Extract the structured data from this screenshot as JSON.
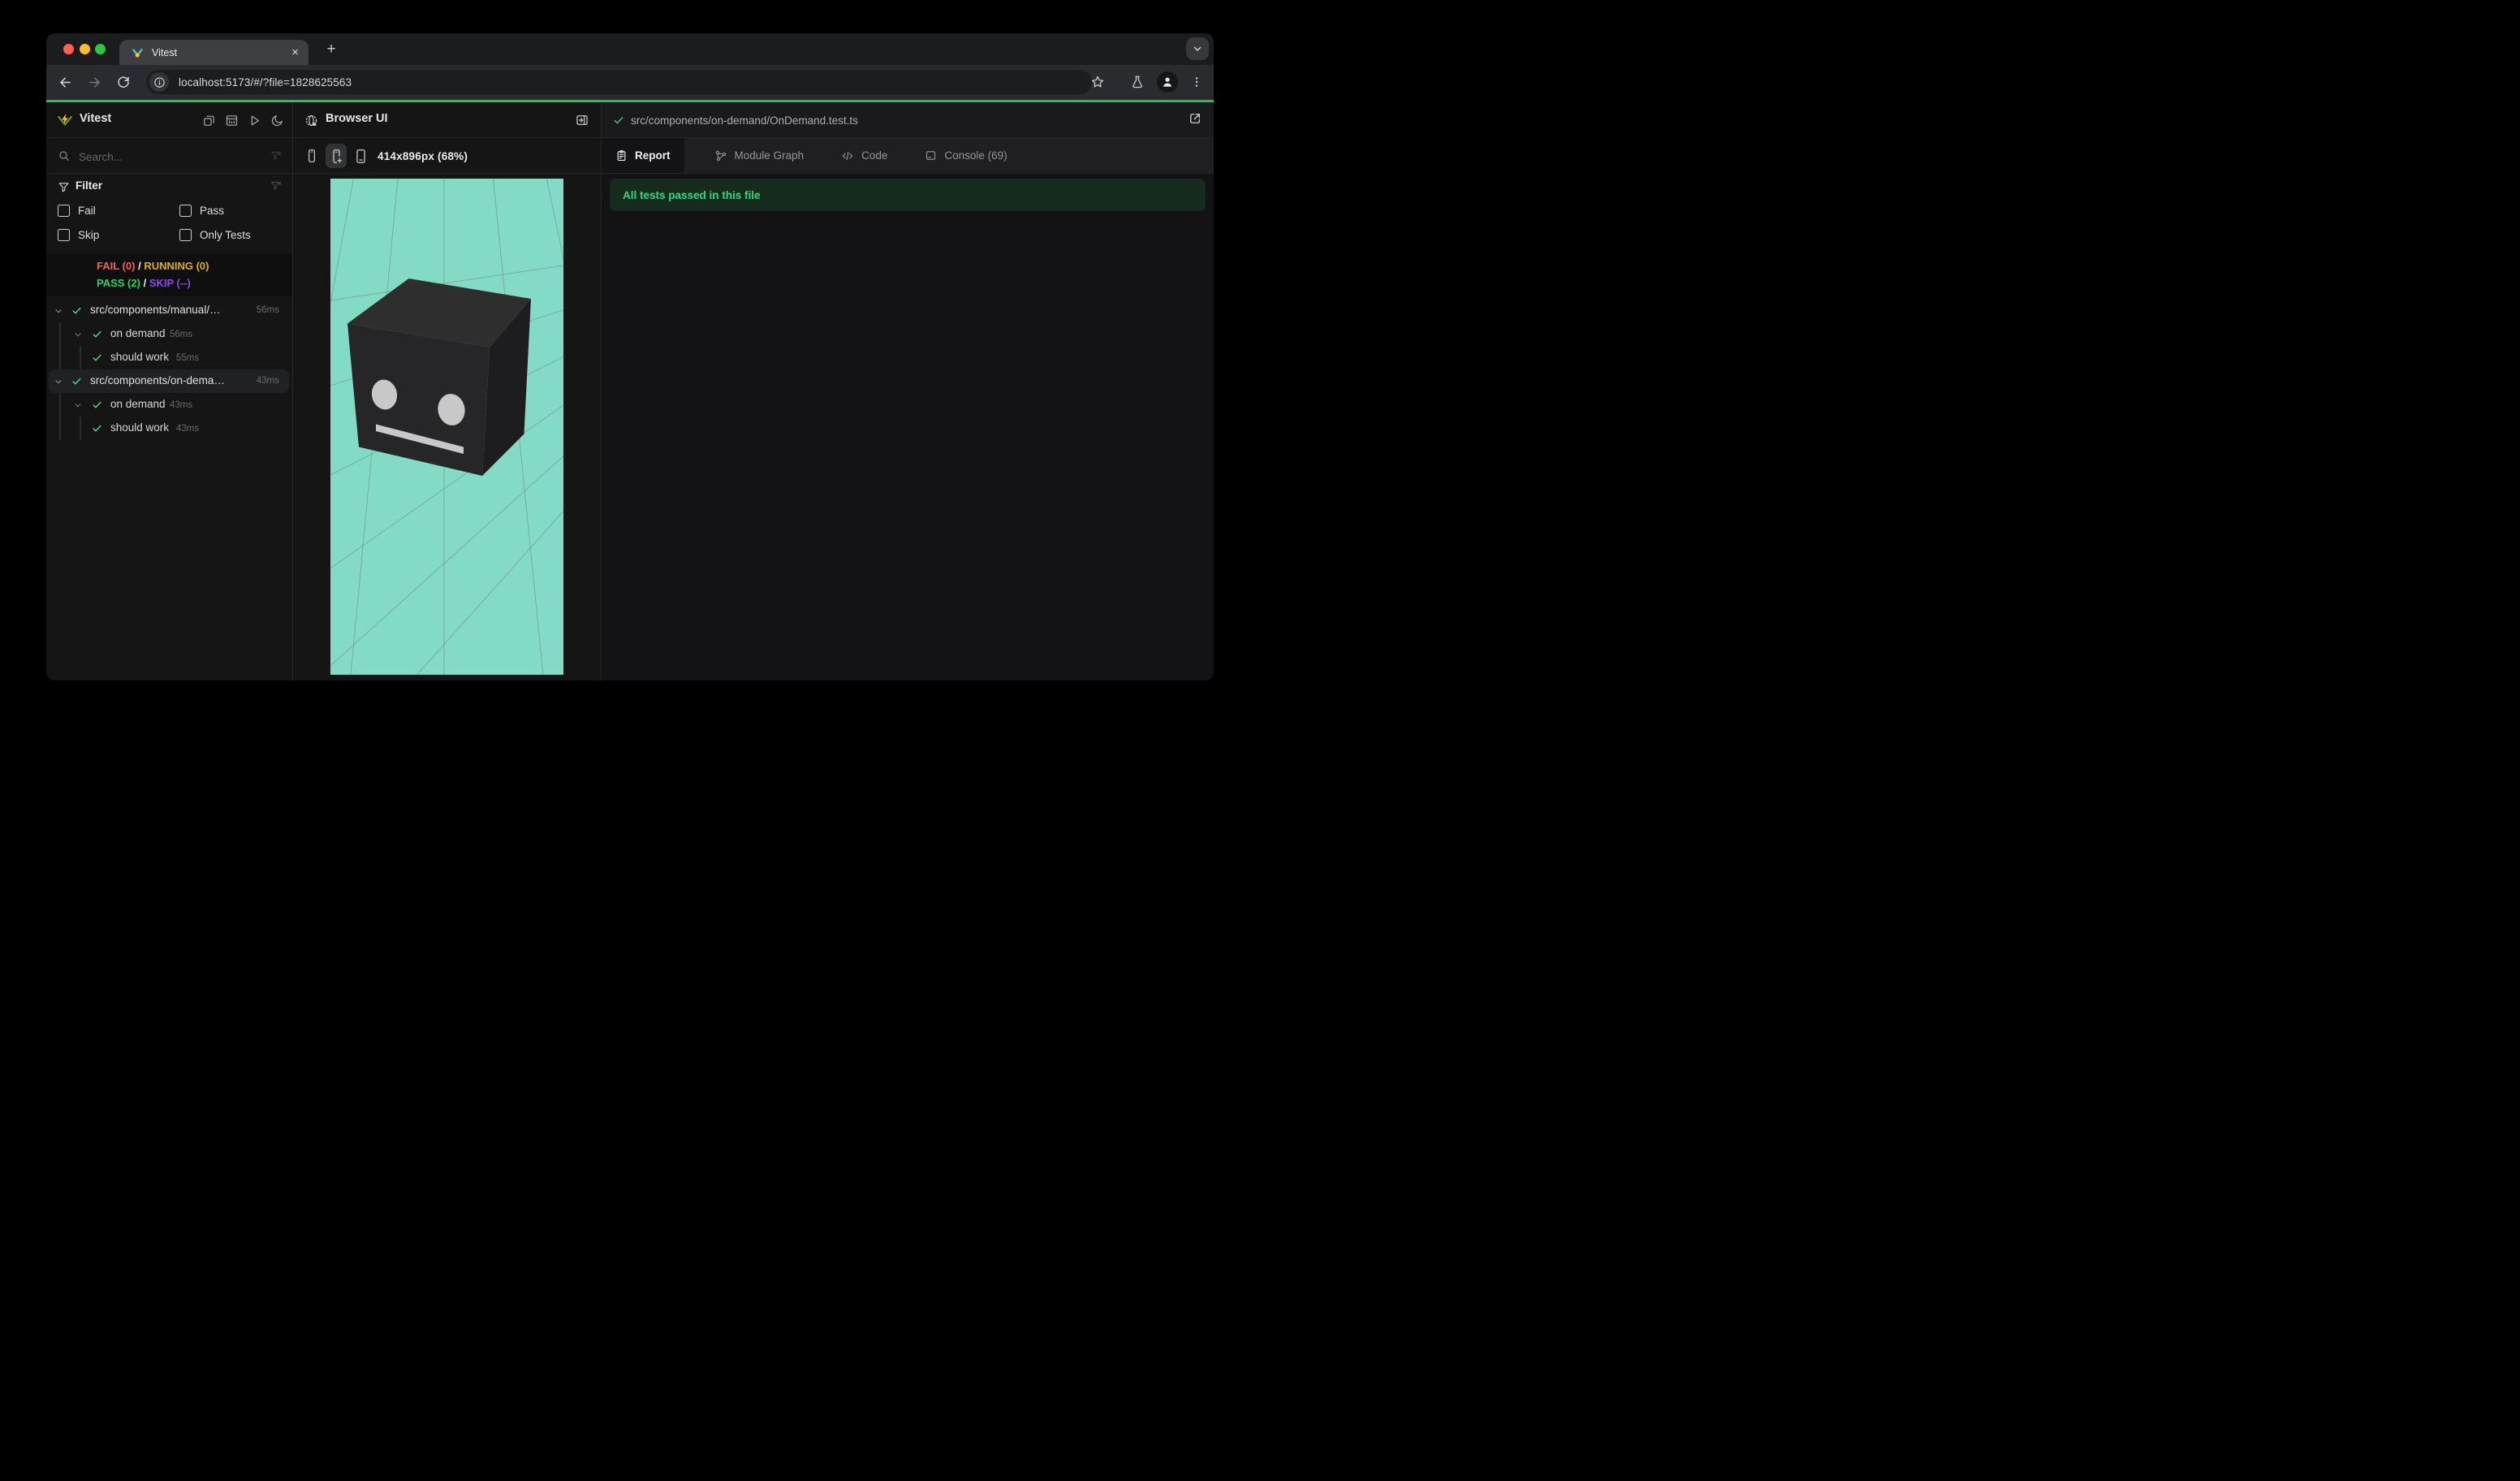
{
  "browser": {
    "tab_title": "Vitest",
    "close_glyph": "×",
    "new_tab_glyph": "+",
    "url": "localhost:5173/#/?file=1828625563"
  },
  "sidebar": {
    "title": "Vitest",
    "search_placeholder": "Search...",
    "filter_title": "Filter",
    "filters": {
      "fail": "Fail",
      "pass": "Pass",
      "skip": "Skip",
      "only": "Only Tests"
    },
    "status": {
      "fail": "FAIL (0)",
      "running": "RUNNING (0)",
      "pass": "PASS (2)",
      "skip": "SKIP (--)",
      "sep": "/"
    },
    "tree": [
      {
        "label": "src/components/manual/…",
        "duration": "56ms"
      },
      {
        "label": "on demand",
        "duration": "56ms"
      },
      {
        "label": "should work",
        "duration": "55ms"
      },
      {
        "label": "src/components/on-dema…",
        "duration": "43ms"
      },
      {
        "label": "on demand",
        "duration": "43ms"
      },
      {
        "label": "should work",
        "duration": "43ms"
      }
    ]
  },
  "preview": {
    "title": "Browser UI",
    "resolution": "414x896px (68%)"
  },
  "report": {
    "file_path": "src/components/on-demand/OnDemand.test.ts",
    "tabs": [
      {
        "label": "Report"
      },
      {
        "label": "Module Graph"
      },
      {
        "label": "Code"
      },
      {
        "label": "Console (69)"
      }
    ],
    "banner": "All tests passed in this file"
  },
  "colors": {
    "accent_green": "#25c05a",
    "pass_green": "#2fd980",
    "fail_red": "#f2605c",
    "running_yellow": "#dfae0a",
    "skip_purple": "#8a4dea",
    "check_green": "#4ade80",
    "viewport_bg": "#84dbc5",
    "banner_bg": "#152b1e",
    "brand_yellow": "#fcc72b",
    "brand_green": "#729b1b"
  }
}
